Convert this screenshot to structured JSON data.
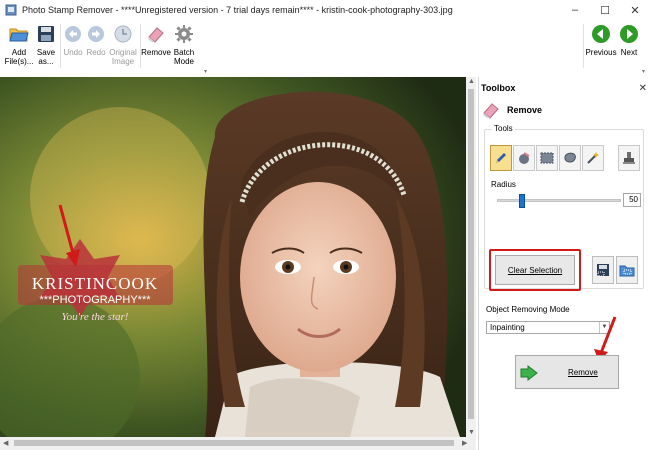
{
  "window": {
    "title": "Photo Stamp Remover - ****Unregistered version - 7 trial days remain**** - kristin-cook-photography-303.jpg",
    "minimize_glyph": "–",
    "maximize_glyph": "☐",
    "close_glyph": "✕"
  },
  "toolbar": {
    "add_files_label": "Add\nFile(s)...",
    "save_as_label": "Save\nas...",
    "undo_label": "Undo",
    "redo_label": "Redo",
    "original_image_label": "Original\nImage",
    "remove_label": "Remove",
    "batch_mode_label": "Batch\nMode",
    "previous_label": "Previous",
    "next_label": "Next"
  },
  "watermark": {
    "line1": "KRISTINCOOK",
    "line2": "***PHOTOGRAPHY***",
    "line3": "You're the star!"
  },
  "toolbox": {
    "title": "Toolbox",
    "close_glyph": "✕",
    "section_title": "Remove",
    "tools_legend": "Tools",
    "radius_label": "Radius",
    "radius_value": "50",
    "radius_fraction": 0.2,
    "clear_selection_label": "Clear Selection",
    "object_removing_mode_label": "Object Removing Mode",
    "object_removing_mode_value": "Inpainting",
    "remove_button_label": "Remove"
  },
  "colors": {
    "annotation_red": "#d11a1a",
    "nav_green": "#2e9a27",
    "active_tool": "#f7df8f",
    "slider_blue": "#1e73cf"
  },
  "icons": {
    "add_files": "folder-open-icon",
    "save_as": "floppy-disk-icon",
    "undo": "undo-arrow-icon",
    "redo": "redo-arrow-icon",
    "original_image": "clock-icon",
    "remove": "eraser-icon",
    "batch_mode": "gear-icon",
    "previous": "previous-arrow-icon",
    "next": "next-arrow-icon"
  }
}
